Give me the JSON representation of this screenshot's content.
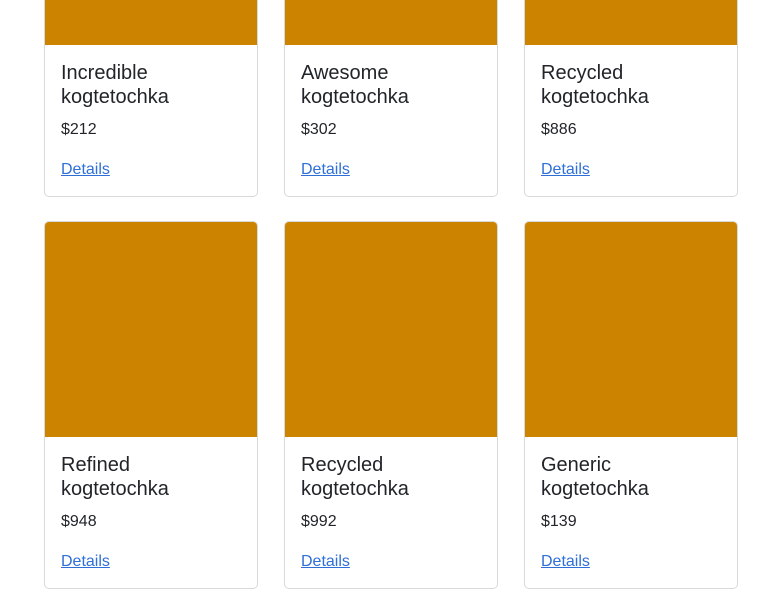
{
  "image_color": "#cc8400",
  "link_color": "#2f6fd6",
  "products": [
    {
      "title": "Incredible kogtetochka",
      "price": "$212",
      "link": "Details"
    },
    {
      "title": "Awesome kogtetochka",
      "price": "$302",
      "link": "Details"
    },
    {
      "title": "Recycled kogtetochka",
      "price": "$886",
      "link": "Details"
    },
    {
      "title": "Refined kogtetochka",
      "price": "$948",
      "link": "Details"
    },
    {
      "title": "Recycled kogtetochka",
      "price": "$992",
      "link": "Details"
    },
    {
      "title": "Generic kogtetochka",
      "price": "$139",
      "link": "Details"
    }
  ]
}
